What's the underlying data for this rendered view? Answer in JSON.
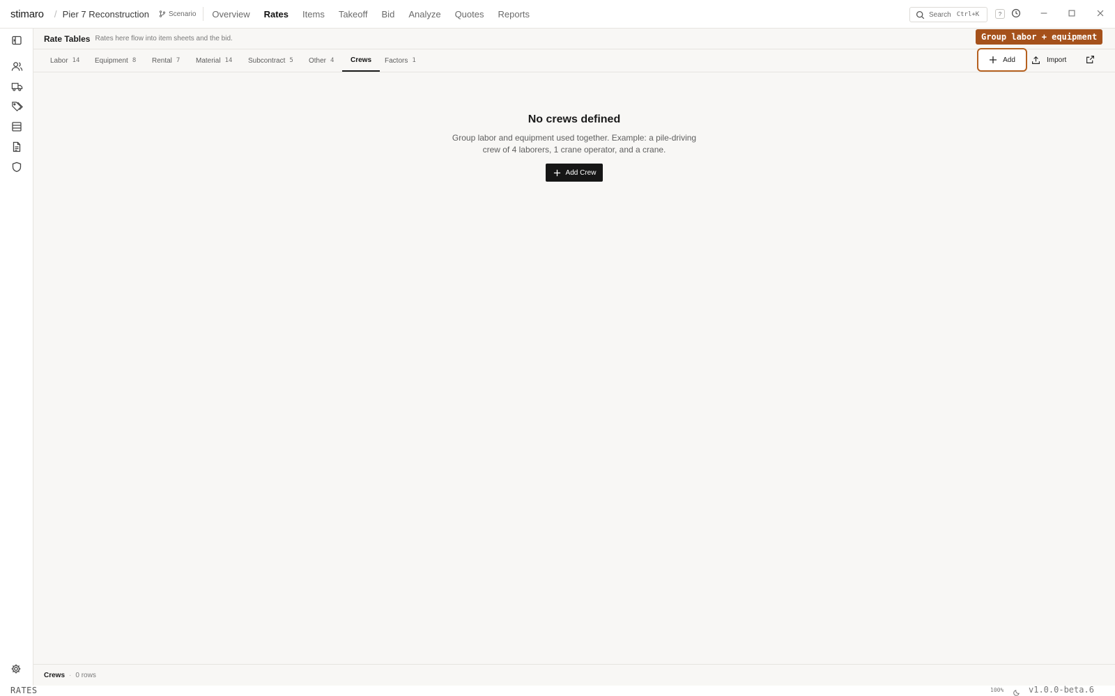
{
  "app": {
    "logo": "stimaro",
    "project": "Pier 7 Reconstruction",
    "scenario_label": "Scenario"
  },
  "nav": {
    "items": [
      {
        "label": "Overview",
        "active": false
      },
      {
        "label": "Rates",
        "active": true
      },
      {
        "label": "Items",
        "active": false
      },
      {
        "label": "Takeoff",
        "active": false
      },
      {
        "label": "Bid",
        "active": false
      },
      {
        "label": "Analyze",
        "active": false
      },
      {
        "label": "Quotes",
        "active": false
      },
      {
        "label": "Reports",
        "active": false
      }
    ]
  },
  "search": {
    "label": "Search",
    "shortcut": "Ctrl+K"
  },
  "help": {
    "label": "?"
  },
  "rail": {
    "icons": [
      "panel-toggle-icon",
      "users-icon",
      "truck-icon",
      "tags-icon",
      "table-icon",
      "document-icon",
      "shield-icon"
    ],
    "bottom_icon": "settings-icon"
  },
  "header": {
    "title": "Rate Tables",
    "subtitle": "Rates here flow into item sheets and the bid."
  },
  "tooltip": {
    "text": "Group labor + equipment"
  },
  "tabs": [
    {
      "label": "Labor",
      "count": "14"
    },
    {
      "label": "Equipment",
      "count": "8"
    },
    {
      "label": "Rental",
      "count": "7"
    },
    {
      "label": "Material",
      "count": "14"
    },
    {
      "label": "Subcontract",
      "count": "5"
    },
    {
      "label": "Other",
      "count": "4"
    },
    {
      "label": "Crews",
      "count": ""
    },
    {
      "label": "Factors",
      "count": "1"
    }
  ],
  "active_tab": "Crews",
  "actions": {
    "add": "Add",
    "import": "Import"
  },
  "empty_state": {
    "title": "No crews defined",
    "description": "Group labor and equipment used together. Example: a pile-driving crew of 4 laborers, 1 crane operator, and a crane.",
    "button": "Add Crew"
  },
  "footer": {
    "table_name": "Crews",
    "separator": "·",
    "rows": "0 rows"
  },
  "statusbar": {
    "mode": "RATES",
    "zoom": "100%",
    "version": "v1.0.0-beta.6"
  },
  "colors": {
    "accent": "#a5511b",
    "accent_border": "#b5601f",
    "primary_button": "#161616",
    "background": "#f8f7f5"
  }
}
